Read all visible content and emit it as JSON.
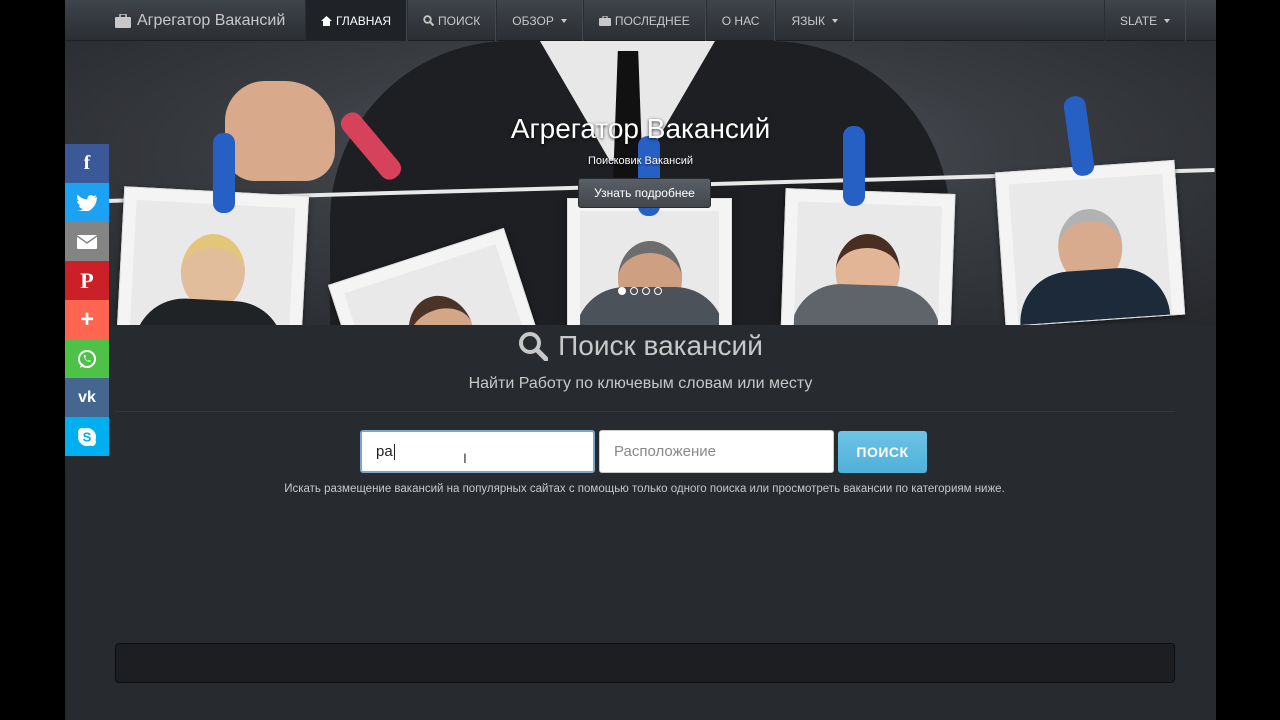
{
  "navbar": {
    "brand": "Агрегатор Вакансий",
    "items": [
      {
        "label": "ГЛАВНАЯ"
      },
      {
        "label": "ПОИСК"
      },
      {
        "label": "ОБЗОР"
      },
      {
        "label": "ПОСЛЕДНЕЕ"
      },
      {
        "label": "О НАС"
      },
      {
        "label": "ЯЗЫК"
      }
    ],
    "theme": "SLATE"
  },
  "hero": {
    "title": "Агрегатор Вакансий",
    "subtitle": "Поисковик Вакансий",
    "button": "Узнать подробнее",
    "slides": 4,
    "active_slide": 1
  },
  "search": {
    "title": "Поиск вакансий",
    "subtitle": "Найти Работу по ключевым словам или месту",
    "keyword_value": "ра",
    "location_placeholder": "Расположение",
    "button": "ПОИСК",
    "help": "Искать размещение вакансий на популярных сайтах с помощью только одного поиска или просмотреть вакансии по категориям ниже."
  },
  "share": [
    {
      "icon": "facebook-icon",
      "color": "#3b5998"
    },
    {
      "icon": "twitter-icon",
      "color": "#1da1f2"
    },
    {
      "icon": "email-icon",
      "color": "#848484"
    },
    {
      "icon": "pinterest-icon",
      "color": "#cb2027"
    },
    {
      "icon": "plus-icon",
      "color": "#ff6550"
    },
    {
      "icon": "whatsapp-icon",
      "color": "#4dc247"
    },
    {
      "icon": "vk-icon",
      "color": "#45668e"
    },
    {
      "icon": "skype-icon",
      "color": "#00aff0"
    }
  ]
}
